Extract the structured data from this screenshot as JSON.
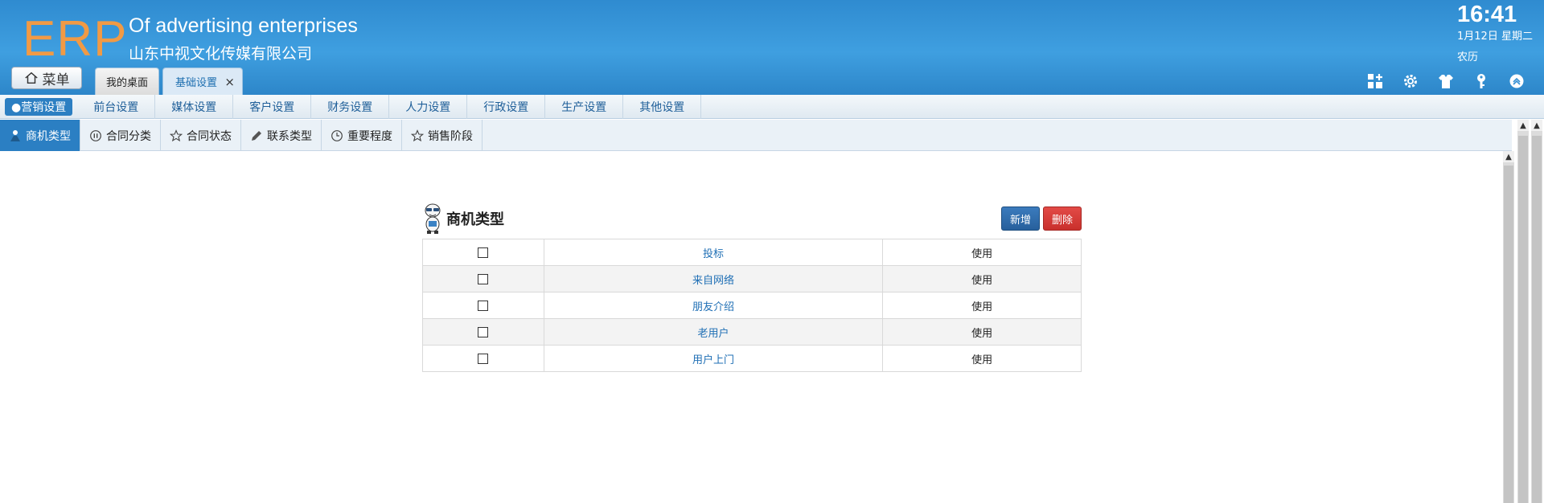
{
  "header": {
    "logo": "ERP",
    "company_en": "Of advertising enterprises",
    "company_cn": "山东中视文化传媒有限公司",
    "time": "16:41",
    "date": "1月12日 星期二",
    "lunar": "农历",
    "menu_label": "菜单",
    "tabs": [
      {
        "label": "我的桌面",
        "active": false
      },
      {
        "label": "基础设置",
        "active": true,
        "close": "×"
      }
    ],
    "icons": [
      "dashboard-add-icon",
      "gear-icon",
      "shirt-icon",
      "key-icon",
      "chevron-up-icon"
    ]
  },
  "subnav": {
    "items": [
      {
        "label": "●营销设置",
        "active": true
      },
      {
        "label": "前台设置"
      },
      {
        "label": "媒体设置"
      },
      {
        "label": "客户设置"
      },
      {
        "label": "财务设置"
      },
      {
        "label": "人力设置"
      },
      {
        "label": "行政设置"
      },
      {
        "label": "生产设置"
      },
      {
        "label": "其他设置"
      }
    ]
  },
  "typetabs": {
    "items": [
      {
        "label": "商机类型",
        "icon": "person-icon",
        "active": true
      },
      {
        "label": "合同分类",
        "icon": "pause-circle-icon"
      },
      {
        "label": "合同状态",
        "icon": "star-icon"
      },
      {
        "label": "联系类型",
        "icon": "pencil-icon"
      },
      {
        "label": "重要程度",
        "icon": "clock-icon"
      },
      {
        "label": "销售阶段",
        "icon": "star-icon"
      }
    ]
  },
  "panel": {
    "title": "商机类型",
    "btn_new": "新增",
    "btn_delete": "删除",
    "rows": [
      {
        "name": "投标",
        "status": "使用"
      },
      {
        "name": "来自网络",
        "status": "使用"
      },
      {
        "name": "朋友介绍",
        "status": "使用"
      },
      {
        "name": "老用户",
        "status": "使用"
      },
      {
        "name": "用户上门",
        "status": "使用"
      }
    ]
  },
  "colors": {
    "header_blue": "#3f9fe0",
    "logo_orange": "#f19a45",
    "active_blue": "#2b7fc3",
    "link_blue": "#1f6fb5",
    "delete_red": "#c9302c"
  }
}
